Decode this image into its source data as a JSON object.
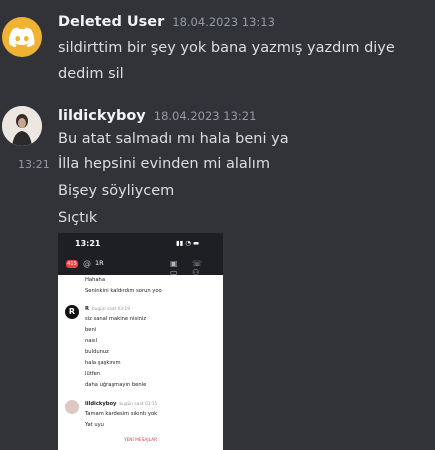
{
  "colors": {
    "background": "#313338",
    "username": "#f2f3f5",
    "timestamp": "#949ba4",
    "text": "#dbdee1",
    "discord_avatar": "#f0b232"
  },
  "messages": [
    {
      "author": "Deleted User",
      "timestamp": "18.04.2023 13:13",
      "avatar_icon": "discord-logo-icon",
      "lines": [
        "sildirttim bir şey yok bana yazmış yazdım diye",
        "dedim sil"
      ]
    },
    {
      "author": "lildickyboy",
      "timestamp": "18.04.2023 13:21",
      "hover_time": "13:21",
      "lines": [
        "Bu atat salmadı mı hala beni ya",
        "İlla hepsini evinden mi alalım",
        "Bişey söyliycem",
        "Sıçtık"
      ]
    }
  ],
  "attachment": {
    "status_time": "13:21",
    "status_icons": "▮▮ ◔ ▬",
    "badge": "415",
    "channel": "1R",
    "header_icons": "▣ ☏ ▭ ⚇",
    "lines_top": [
      "Hahaha",
      "Seninkini kaldırdım sorun yoo"
    ],
    "r_author": "R",
    "r_time": "bugün saat 03:19",
    "r_lines": [
      "siz sanal makine nisiniz",
      "beni",
      "nasıl",
      "buldunuz",
      "hala şaşkınım",
      "lütfen",
      "daha uğraşmayın benle"
    ],
    "l_author": "lildickyboy",
    "l_time": "bugün saat 03:15",
    "l_lines": [
      "Tamam kardesim sıkıntı yok",
      "Yat uyu"
    ],
    "new_messages": "YENİ MESAJLAR"
  }
}
